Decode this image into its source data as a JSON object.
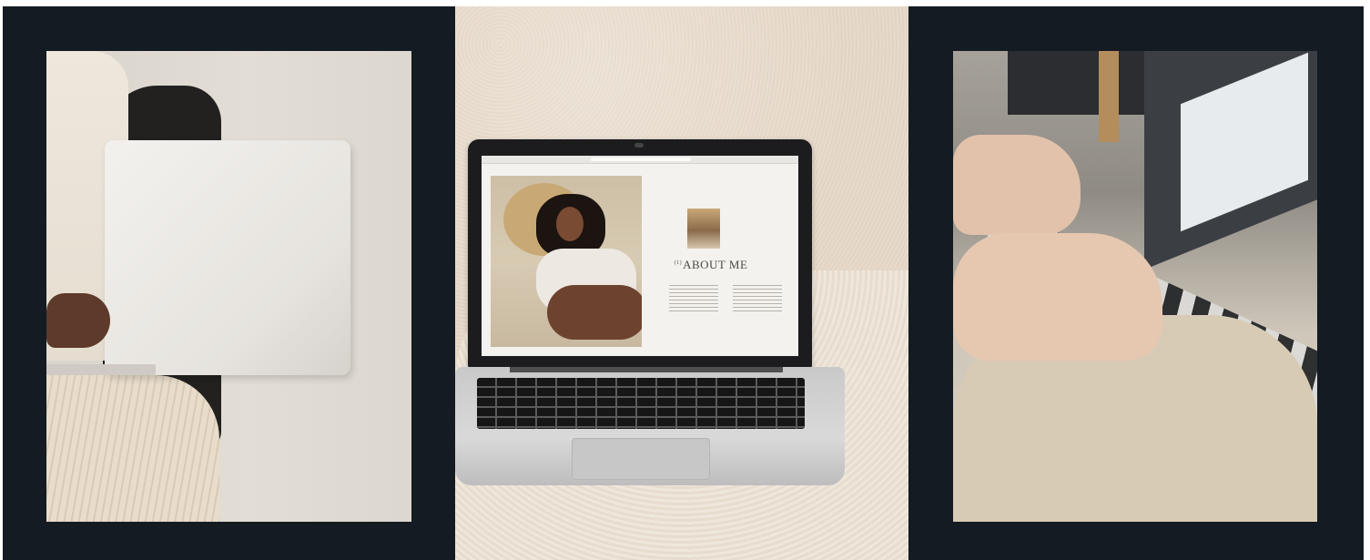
{
  "panels": [
    {
      "id": "left",
      "icon": "laptop-photo-icon"
    },
    {
      "id": "center",
      "icon": "macbook-website-icon"
    },
    {
      "id": "right",
      "icon": "laptop-drawing-icon"
    }
  ],
  "website_mockup": {
    "title_prefix": "(1)",
    "title": "ABOUT ME"
  },
  "colors": {
    "frame": "#141b22",
    "wall": "#e9ddd0",
    "screen": "#f4f2ee"
  }
}
